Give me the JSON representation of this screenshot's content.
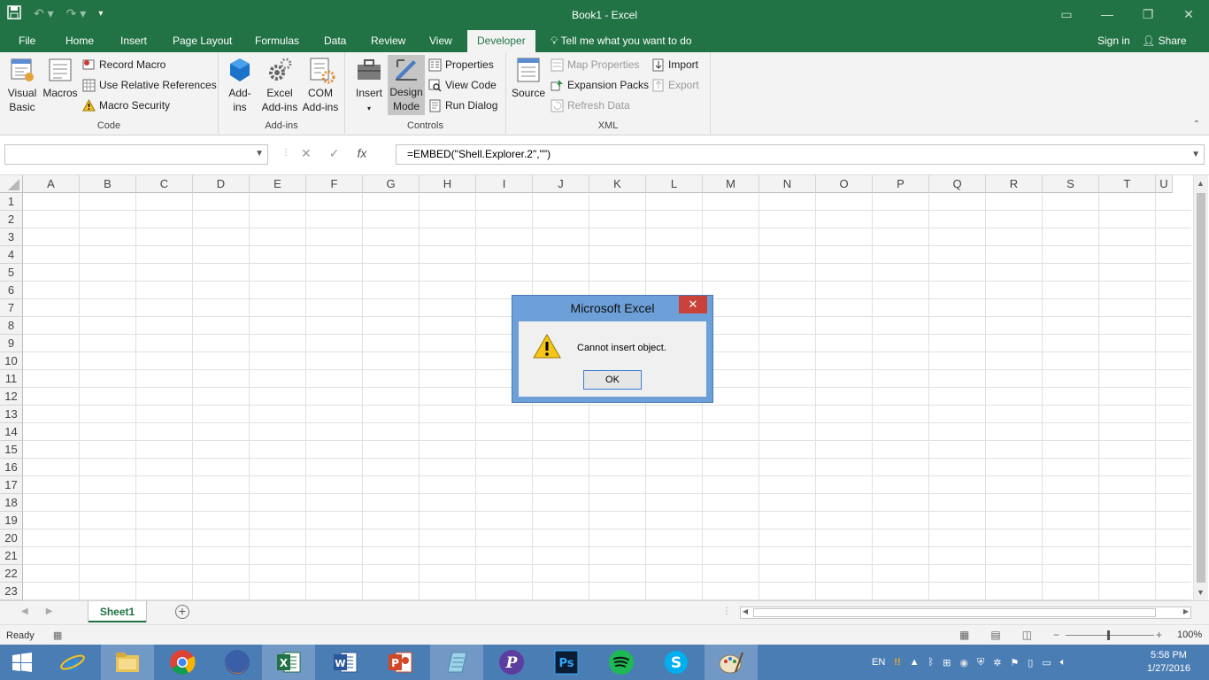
{
  "window": {
    "title": "Book1 - Excel"
  },
  "tabs": [
    {
      "label": "File"
    },
    {
      "label": "Home"
    },
    {
      "label": "Insert"
    },
    {
      "label": "Page Layout"
    },
    {
      "label": "Formulas"
    },
    {
      "label": "Data"
    },
    {
      "label": "Review"
    },
    {
      "label": "View"
    },
    {
      "label": "Developer"
    }
  ],
  "tellme": "Tell me what you want to do",
  "signin": "Sign in",
  "share": "Share",
  "ribbon": {
    "code": {
      "label": "Code",
      "visual_basic": "Visual Basic",
      "macros": "Macros",
      "record_macro": "Record Macro",
      "relative_refs": "Use Relative References",
      "macro_security": "Macro Security"
    },
    "addins": {
      "label": "Add-ins",
      "addins": "Add-ins",
      "excel_addins": "Excel Add-ins",
      "com_addins": "COM Add-ins"
    },
    "controls": {
      "label": "Controls",
      "insert": "Insert",
      "design_mode": "Design Mode",
      "properties": "Properties",
      "view_code": "View Code",
      "run_dialog": "Run Dialog"
    },
    "xml": {
      "label": "XML",
      "source": "Source",
      "map_properties": "Map Properties",
      "expansion_packs": "Expansion Packs",
      "refresh_data": "Refresh Data",
      "import": "Import",
      "export": "Export"
    }
  },
  "formula_bar": {
    "name_box": "",
    "formula": "=EMBED(\"Shell.Explorer.2\",\"\")"
  },
  "columns": [
    "A",
    "B",
    "C",
    "D",
    "E",
    "F",
    "G",
    "H",
    "I",
    "J",
    "K",
    "L",
    "M",
    "N",
    "O",
    "P",
    "Q",
    "R",
    "S",
    "T",
    "U"
  ],
  "rows": [
    "1",
    "2",
    "3",
    "4",
    "5",
    "6",
    "7",
    "8",
    "9",
    "10",
    "11",
    "12",
    "13",
    "14",
    "15",
    "16",
    "17",
    "18",
    "19",
    "20",
    "21",
    "22",
    "23"
  ],
  "sheet": {
    "tab": "Sheet1"
  },
  "status": {
    "ready": "Ready",
    "zoom": "100%"
  },
  "dialog": {
    "title": "Microsoft Excel",
    "message": "Cannot insert object.",
    "ok": "OK"
  },
  "taskbar": {
    "lang": "EN",
    "time": "5:58 PM",
    "date": "1/27/2016",
    "apps": [
      "windows-start",
      "internet-explorer",
      "file-explorer",
      "chrome",
      "firefox",
      "excel",
      "word",
      "powerpoint",
      "notepad",
      "peerblock",
      "photoshop",
      "spotify",
      "skype",
      "paint"
    ]
  },
  "colors": {
    "accent": "#217346",
    "taskbar": "#4b7db5"
  }
}
